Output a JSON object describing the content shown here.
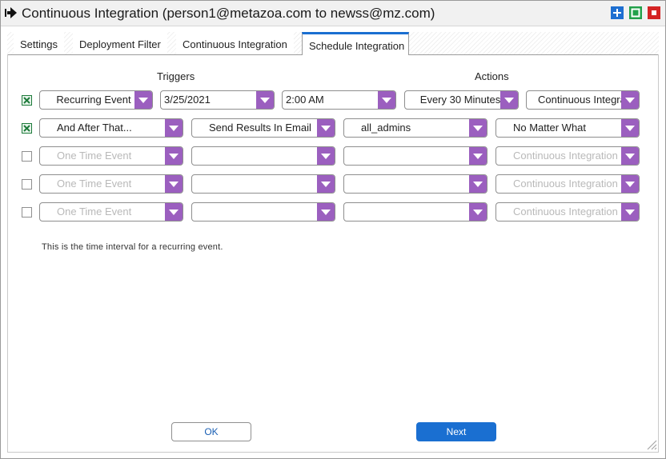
{
  "window": {
    "title": "Continuous Integration (person1@metazoa.com to newss@mz.com)",
    "controls": [
      "add-icon",
      "maximize-icon",
      "close-icon"
    ],
    "colors": {
      "add": "#1e6fd1",
      "maximize": "#22a04a",
      "close": "#d42424"
    }
  },
  "tabs": [
    {
      "label": "Settings",
      "active": false
    },
    {
      "label": "Deployment Filter",
      "active": false
    },
    {
      "label": "Continuous Integration",
      "active": false
    },
    {
      "label": "Schedule Integration",
      "active": true
    }
  ],
  "headers": {
    "triggers": "Triggers",
    "actions": "Actions"
  },
  "rows": [
    {
      "checked": true,
      "fields": [
        "Recurring Event",
        "3/25/2021",
        "2:00 AM",
        "Every 30 Minutes",
        "Continuous Integration"
      ]
    },
    {
      "checked": true,
      "fields": [
        "And After That...",
        "Send Results In Email",
        "all_admins",
        "No Matter What"
      ]
    },
    {
      "checked": false,
      "fields": [
        "One Time Event",
        "",
        "",
        "Continuous Integration"
      ]
    },
    {
      "checked": false,
      "fields": [
        "One Time Event",
        "",
        "",
        "Continuous Integration"
      ]
    },
    {
      "checked": false,
      "fields": [
        "One Time Event",
        "",
        "",
        "Continuous Integration"
      ]
    }
  ],
  "hint": "This is the time interval for a recurring event.",
  "buttons": {
    "ok": "OK",
    "next": "Next"
  },
  "accent": {
    "dropdown_arrow": "#9b5fbf",
    "primary": "#1a6fd1",
    "checkbox": "#1d7a3a"
  }
}
